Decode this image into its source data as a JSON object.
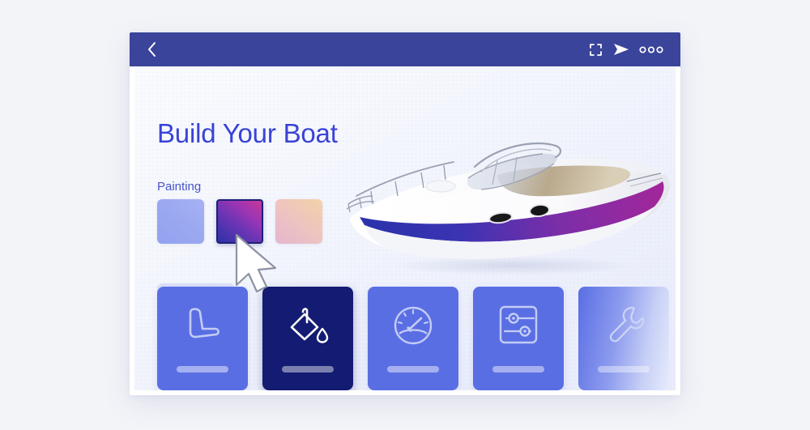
{
  "app": {
    "background_color": "#f3f4f8",
    "card_border_color": "#ffffff"
  },
  "title_bar": {
    "background_color": "#3a449a",
    "back_icon": "chevron-left-icon",
    "actions": [
      {
        "icon": "fullscreen-icon",
        "label": "Fullscreen"
      },
      {
        "icon": "send-icon",
        "label": "Send"
      },
      {
        "icon": "more-options-icon",
        "label": "More options"
      }
    ]
  },
  "main": {
    "page_title": "Build Your Boat",
    "section_label": "Painting",
    "title_color": "#3943d6",
    "label_color": "#4755c8"
  },
  "painting": {
    "swatches": [
      {
        "name": "periwinkle-blue",
        "selected": false,
        "gradient": "linear-gradient(40deg, #93a2ef 0%, #9aa8f1 50%, #a7b2f2 100%)"
      },
      {
        "name": "blue-magenta",
        "selected": true,
        "gradient": "linear-gradient(38deg, #2e31a8 0%, #6935b4 42%, #9d35b4 70%, #c73895 100%)"
      },
      {
        "name": "pink-peach",
        "selected": false,
        "gradient": "linear-gradient(38deg, #e4b6cf 0%, #eec3c0 48%, #f3d2a8 100%)"
      }
    ],
    "placeholder_bar": true
  },
  "boat": {
    "name": "speedboat-render",
    "hull_color": "#ffffff",
    "stripe_gradient_start": "#2b32ab",
    "stripe_gradient_end": "#a4269a"
  },
  "categories": [
    {
      "name": "seat",
      "icon": "seat-icon",
      "selected": false,
      "faded": false
    },
    {
      "name": "painting",
      "icon": "paint-bucket-icon",
      "selected": true,
      "faded": false
    },
    {
      "name": "gauge",
      "icon": "gauge-icon",
      "selected": false,
      "faded": false
    },
    {
      "name": "controls",
      "icon": "sliders-icon",
      "selected": false,
      "faded": false
    },
    {
      "name": "tools",
      "icon": "wrench-icon",
      "selected": false,
      "faded": true
    }
  ],
  "cursor": {
    "name": "mouse-pointer",
    "visible": true
  }
}
